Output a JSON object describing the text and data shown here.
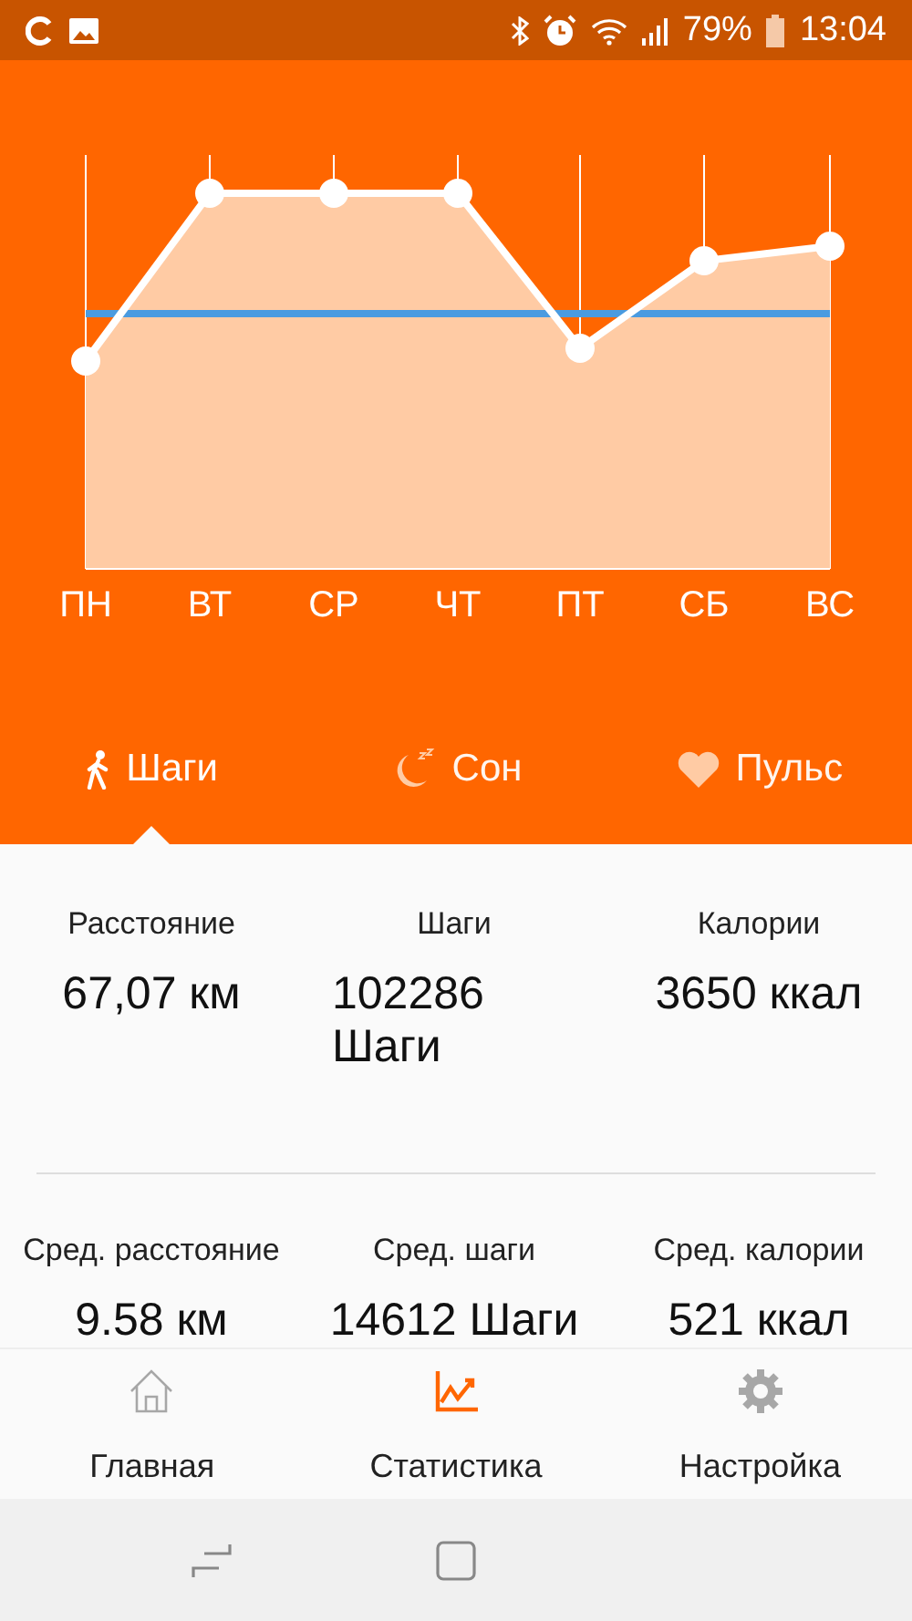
{
  "status_bar": {
    "battery": "79%",
    "time": "13:04"
  },
  "chart": {
    "days": [
      "ПН",
      "ВТ",
      "СР",
      "ЧТ",
      "ПТ",
      "СБ",
      "ВС"
    ]
  },
  "tabs": [
    {
      "label": "Шаги",
      "kind": "steps",
      "selected": true
    },
    {
      "label": "Сон",
      "kind": "sleep",
      "selected": false
    },
    {
      "label": "Пульс",
      "kind": "pulse",
      "selected": false
    }
  ],
  "stats": [
    [
      {
        "label": "Расстояние",
        "value": "67,07 км"
      },
      {
        "label": "Шаги",
        "value": "102286 Шаги"
      },
      {
        "label": "Калории",
        "value": "3650 ккал"
      }
    ],
    [
      {
        "label": "Сред. расстояние",
        "value": "9.58 км"
      },
      {
        "label": "Сред. шаги",
        "value": "14612 Шаги"
      },
      {
        "label": "Сред. калории",
        "value": "521 ккал"
      }
    ]
  ],
  "bottom_nav": [
    {
      "label": "Главная",
      "kind": "home",
      "selected": false
    },
    {
      "label": "Статистика",
      "kind": "stats",
      "selected": true
    },
    {
      "label": "Настройка",
      "kind": "settings",
      "selected": false
    }
  ]
}
